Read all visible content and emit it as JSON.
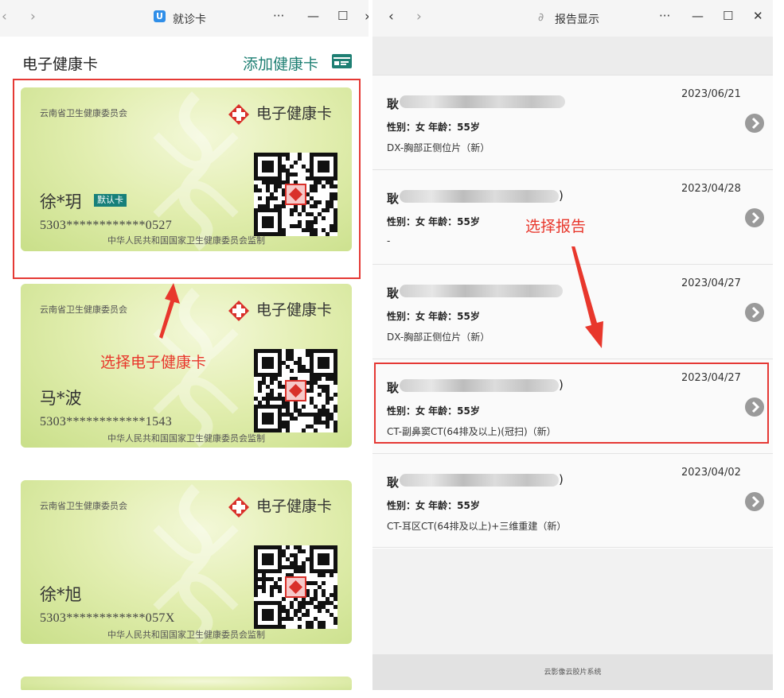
{
  "left_window": {
    "title": "就诊卡",
    "logo_letter": "U",
    "controls": {
      "more": "···",
      "minimize": "—",
      "maximize": "☐"
    },
    "page_title": "电子健康卡",
    "add_card_label": "添加健康卡",
    "cards": [
      {
        "issuer": "云南省卫生健康委员会",
        "brand": "电子健康卡",
        "name": "徐*玥",
        "number": "5303************0527",
        "badge": "默认卡",
        "footer": "中华人民共和国国家卫生健康委员会监制"
      },
      {
        "issuer": "云南省卫生健康委员会",
        "brand": "电子健康卡",
        "name": "马*波",
        "number": "5303************1543",
        "footer": "中华人民共和国国家卫生健康委员会监制"
      },
      {
        "issuer": "云南省卫生健康委员会",
        "brand": "电子健康卡",
        "name": "徐*旭",
        "number": "5303************057X",
        "footer": "中华人民共和国国家卫生健康委员会监制"
      }
    ],
    "annotation": "选择电子健康卡"
  },
  "right_window": {
    "title": "报告显示",
    "controls": {
      "more": "···",
      "minimize": "—",
      "maximize": "☐",
      "close": "✕"
    },
    "annotation": "选择报告",
    "reports": [
      {
        "name_prefix": "耿",
        "name_suffix": "",
        "date": "2023/06/21",
        "info": "性别：女 年龄：55岁",
        "exam": "DX-胸部正侧位片（新）"
      },
      {
        "name_prefix": "耿",
        "name_suffix": ")",
        "date": "2023/04/28",
        "info": "性别：女 年龄：55岁",
        "exam": "-"
      },
      {
        "name_prefix": "耿",
        "name_suffix": "",
        "date": "2023/04/27",
        "info": "性别：女 年龄：55岁",
        "exam": "DX-胸部正侧位片（新）"
      },
      {
        "name_prefix": "耿",
        "name_suffix": ")",
        "date": "2023/04/27",
        "info": "性别：女 年龄：55岁",
        "exam": "CT-副鼻窦CT(64排及以上)(冠扫)（新）"
      },
      {
        "name_prefix": "耿",
        "name_suffix": ")",
        "date": "2023/04/02",
        "info": "性别：女 年龄：55岁",
        "exam": "CT-耳区CT(64排及以上)+三维重建（新）"
      }
    ],
    "footer": "云影像云胶片系统"
  },
  "colors": {
    "accent": "#1e7f73",
    "annotation": "#e8372c",
    "card_green": "#d6e79f"
  }
}
